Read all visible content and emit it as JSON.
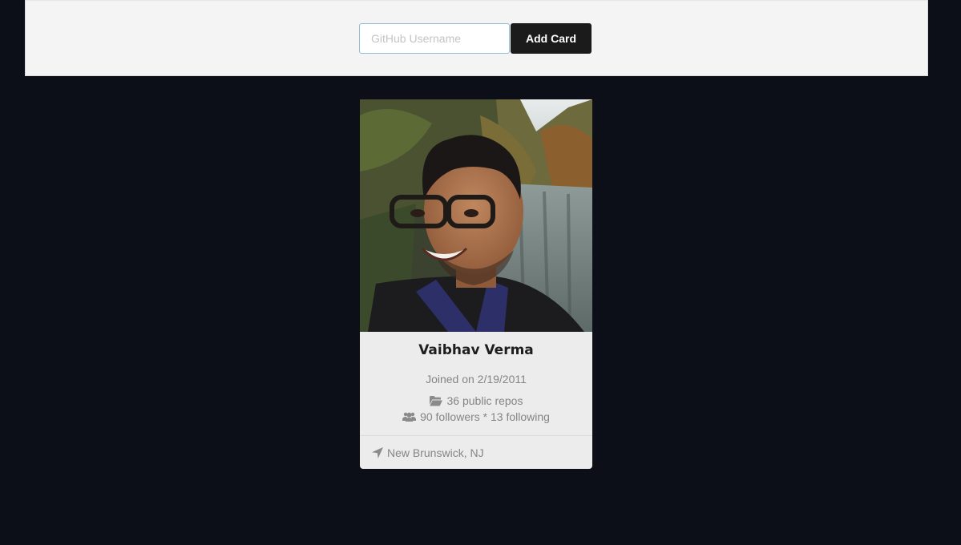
{
  "search": {
    "placeholder": "GitHub Username",
    "value": ""
  },
  "toolbar": {
    "add_label": "Add Card"
  },
  "card": {
    "name": "Vaibhav Verma",
    "joined": "Joined on 2/19/2011",
    "repos": "36 public repos",
    "follow": "90 followers * 13 following",
    "location": "New Brunswick, NJ",
    "icons": {
      "repos": "folder-open-icon",
      "follow": "users-icon",
      "location": "location-arrow-icon"
    }
  },
  "colors": {
    "background": "#0c0f17",
    "topbar": "#f4f4f4",
    "button": "#1b1b1b",
    "card": "#ececec",
    "muted_text": "#858585"
  }
}
